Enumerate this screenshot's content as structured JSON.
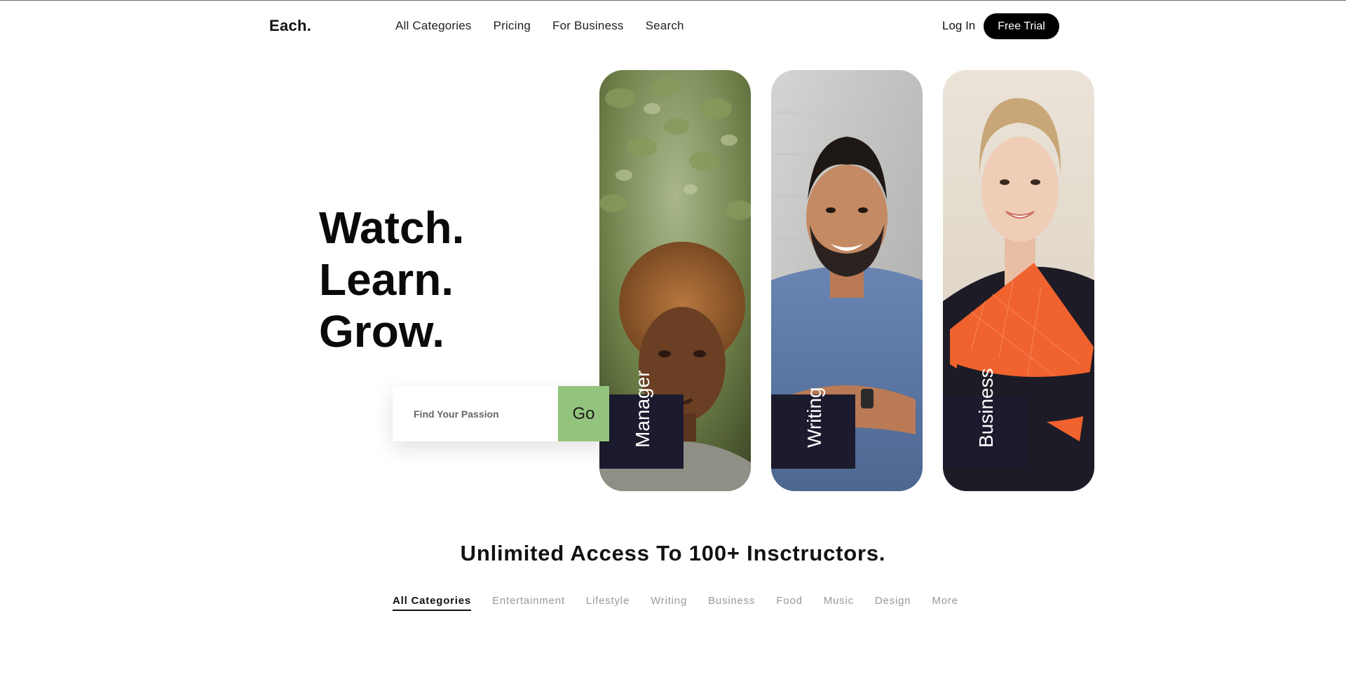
{
  "nav": {
    "logo": "Each.",
    "links": [
      "All Categories",
      "Pricing",
      "For Business",
      "Search"
    ],
    "login": "Log In",
    "trial": "Free Trial"
  },
  "hero": {
    "lines": [
      "Watch.",
      "Learn.",
      "Grow."
    ],
    "search_placeholder": "Find Your Passion",
    "go_label": "Go"
  },
  "cards": [
    {
      "label": "Manager",
      "photo": "woman-curly-hair-portrait"
    },
    {
      "label": "Writing",
      "photo": "bearded-man-arms-crossed"
    },
    {
      "label": "Business",
      "photo": "woman-orange-folder"
    }
  ],
  "section": {
    "title": "Unlimited Access To 100+ Insctructors.",
    "categories": [
      "All Categories",
      "Entertainment",
      "Lifestyle",
      "Writing",
      "Business",
      "Food",
      "Music",
      "Design",
      "More"
    ],
    "active_category": "All Categories"
  },
  "colors": {
    "accent_green": "#93c47d",
    "tag_bg": "#1c1b2e",
    "button_black": "#000000"
  }
}
